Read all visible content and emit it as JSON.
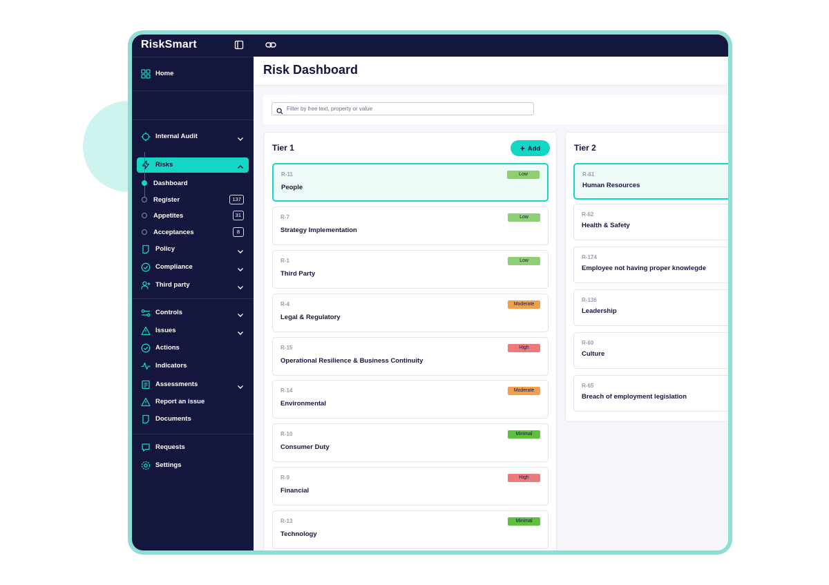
{
  "app": {
    "brand": "RiskSmart"
  },
  "colors": {
    "navy": "#15163d",
    "accent": "#14d6c4",
    "frame": "#8fded6",
    "low": "#8dcf72",
    "moderate": "#f0a04b",
    "high": "#ec7a7a",
    "minimal": "#5fbf3f"
  },
  "sidebar": {
    "home": "Home",
    "internal_audit": "Internal Audit",
    "risks": "Risks",
    "risks_sub": [
      {
        "label": "Dashboard",
        "count": ""
      },
      {
        "label": "Register",
        "count": "137"
      },
      {
        "label": "Appetites",
        "count": "31"
      },
      {
        "label": "Acceptances",
        "count": "8"
      }
    ],
    "policy": "Policy",
    "compliance": "Compliance",
    "third_party": "Third party",
    "controls": "Controls",
    "issues": "Issues",
    "actions": "Actions",
    "indicators": "Indicators",
    "assessments": "Assessments",
    "report_issue": "Report an issue",
    "documents": "Documents",
    "requests": "Requests",
    "settings": "Settings"
  },
  "main": {
    "title": "Risk Dashboard",
    "search_placeholder": "Filter by free text, property or value"
  },
  "tier1": {
    "title": "Tier 1",
    "add_label": "Add",
    "cards": [
      {
        "id": "R-11",
        "name": "People",
        "rating": "Low"
      },
      {
        "id": "R-7",
        "name": "Strategy Implementation",
        "rating": "Low"
      },
      {
        "id": "R-1",
        "name": "Third Party",
        "rating": "Low"
      },
      {
        "id": "R-4",
        "name": "Legal & Regulatory",
        "rating": "Moderate"
      },
      {
        "id": "R-15",
        "name": "Operational Resilience & Business Continuity",
        "rating": "High"
      },
      {
        "id": "R-14",
        "name": "Environmental",
        "rating": "Moderate"
      },
      {
        "id": "R-10",
        "name": "Consumer Duty",
        "rating": "Minimal"
      },
      {
        "id": "R-9",
        "name": "Financial",
        "rating": "High"
      },
      {
        "id": "R-13",
        "name": "Technology",
        "rating": "Minimal"
      }
    ]
  },
  "tier2": {
    "title": "Tier 2",
    "cards": [
      {
        "id": "R-61",
        "name": "Human Resources"
      },
      {
        "id": "R-62",
        "name": "Health & Safety"
      },
      {
        "id": "R-174",
        "name": "Employee not having proper knowlegde"
      },
      {
        "id": "R-136",
        "name": "Leadership"
      },
      {
        "id": "R-60",
        "name": "Culture"
      },
      {
        "id": "R-65",
        "name": "Breach of employment legislation"
      }
    ]
  }
}
